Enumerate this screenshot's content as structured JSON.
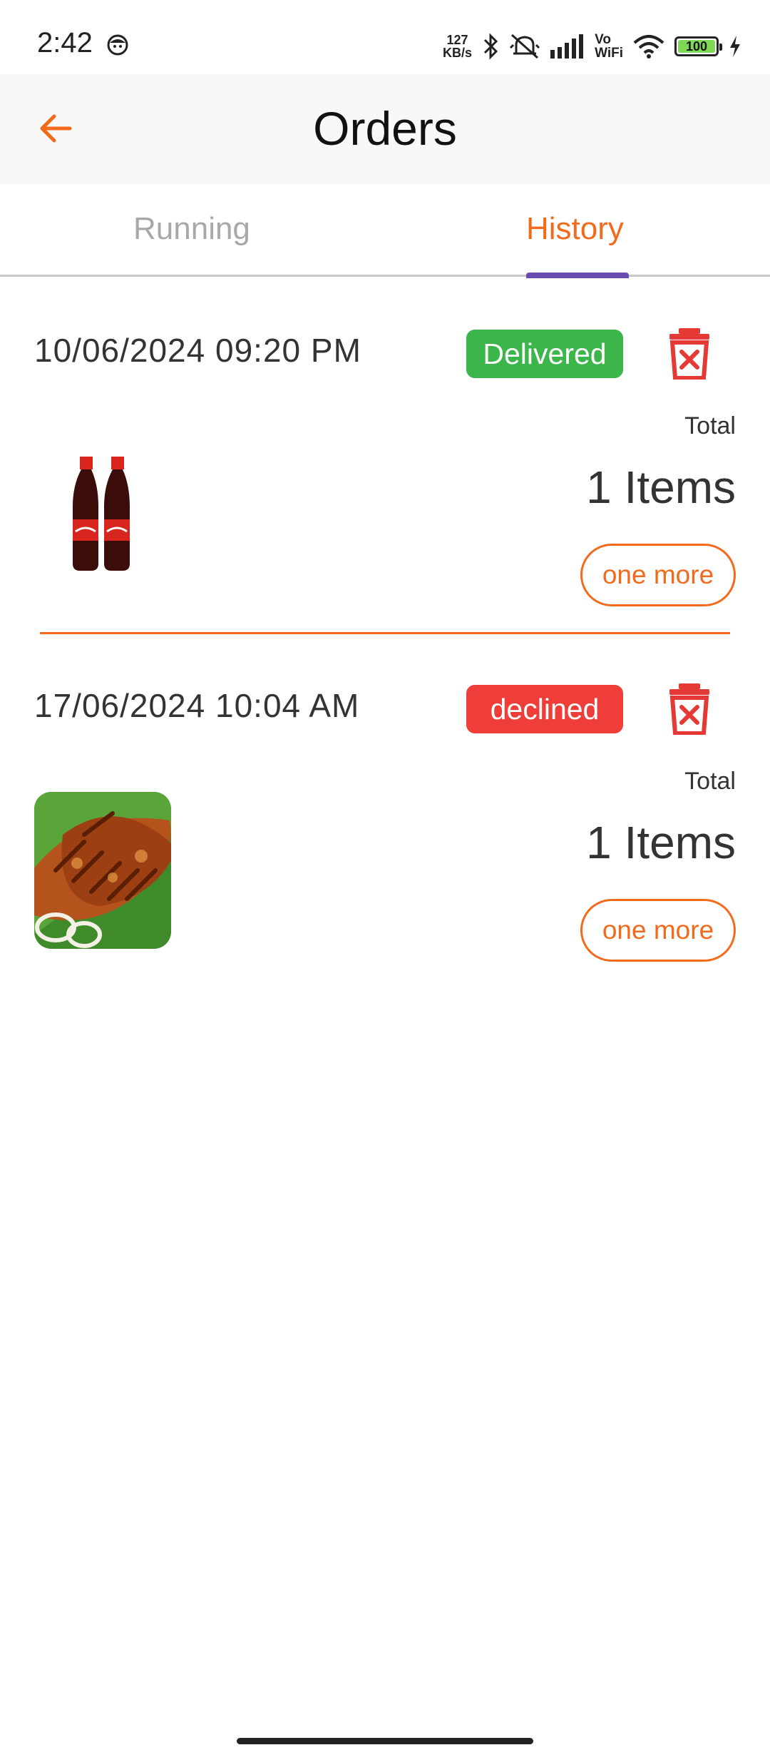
{
  "status_bar": {
    "time": "2:42",
    "net_speed_value": "127",
    "net_speed_unit": "KB/s",
    "vo_top": "Vo",
    "vo_bottom": "WiFi",
    "battery": "100"
  },
  "app_bar": {
    "title": "Orders",
    "back_icon": "arrow-left-icon"
  },
  "tabs": [
    {
      "label": "Running",
      "active": false
    },
    {
      "label": "History",
      "active": true
    }
  ],
  "orders": [
    {
      "date": "10/06/2024 09:20 PM",
      "status": "Delivered",
      "status_color": "#3cb54a",
      "total_label": "Total",
      "items": "1 Items",
      "action": "one more",
      "image": "cola-bottles-image"
    },
    {
      "date": "17/06/2024 10:04 AM",
      "status": "declined",
      "status_color": "#ef3e3a",
      "total_label": "Total",
      "items": "1 Items",
      "action": "one more",
      "image": "fried-fish-image"
    }
  ],
  "colors": {
    "accent": "#f26b1d",
    "tab_indicator": "#6a4cb0",
    "delete": "#e53935"
  }
}
